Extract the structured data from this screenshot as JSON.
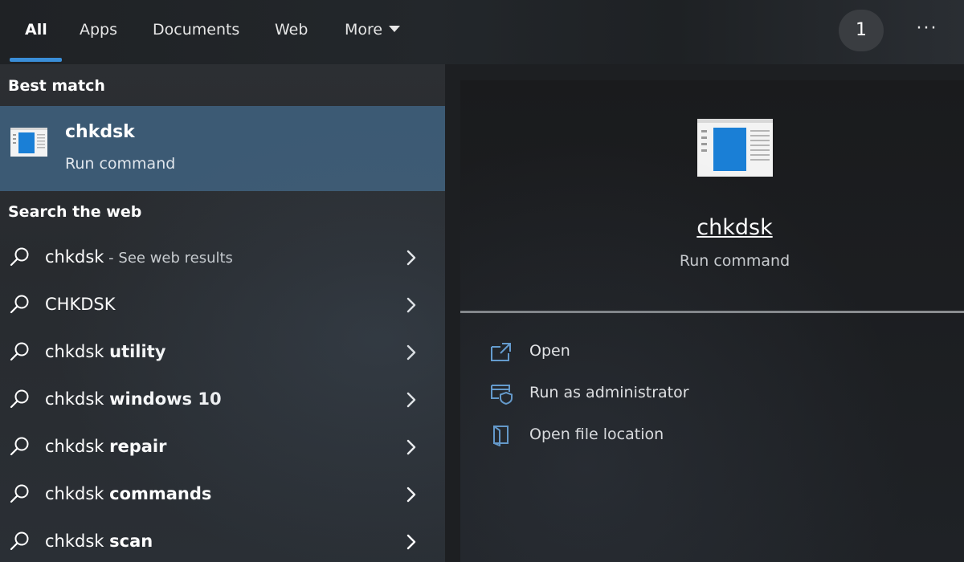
{
  "tabs": [
    {
      "label": "All",
      "active": true
    },
    {
      "label": "Apps"
    },
    {
      "label": "Documents"
    },
    {
      "label": "Web"
    },
    {
      "label": "More"
    }
  ],
  "header": {
    "badge_count": "1",
    "more_options": "···",
    "more_icon": "chevron-down-icon",
    "options_icon": "ellipsis-icon"
  },
  "best_match": {
    "header": "Best match",
    "title": "chkdsk",
    "subtitle": "Run command",
    "icon": "run-command-icon"
  },
  "web": {
    "header": "Search the web",
    "items": [
      {
        "prefix": "chkdsk",
        "bold": "",
        "hint": " - See web results"
      },
      {
        "prefix": "CHKDSK",
        "bold": "",
        "hint": ""
      },
      {
        "prefix": "chkdsk ",
        "bold": "utility",
        "hint": ""
      },
      {
        "prefix": "chkdsk ",
        "bold": "windows 10",
        "hint": ""
      },
      {
        "prefix": "chkdsk ",
        "bold": "repair",
        "hint": ""
      },
      {
        "prefix": "chkdsk ",
        "bold": "commands",
        "hint": ""
      },
      {
        "prefix": "chkdsk ",
        "bold": "scan",
        "hint": ""
      }
    ],
    "item_icon": "search-icon",
    "chevron_icon": "chevron-right-icon"
  },
  "detail": {
    "title": "chkdsk",
    "subtitle": "Run command",
    "actions": [
      {
        "label": "Open",
        "icon": "open-icon"
      },
      {
        "label": "Run as administrator",
        "icon": "admin-shield-icon"
      },
      {
        "label": "Open file location",
        "icon": "folder-location-icon"
      }
    ]
  },
  "colors": {
    "accent": "#3a8ed8",
    "selection": "#3c5a74",
    "icon_blue": "#1a7fd6",
    "action_icon": "#6aa8e0"
  }
}
